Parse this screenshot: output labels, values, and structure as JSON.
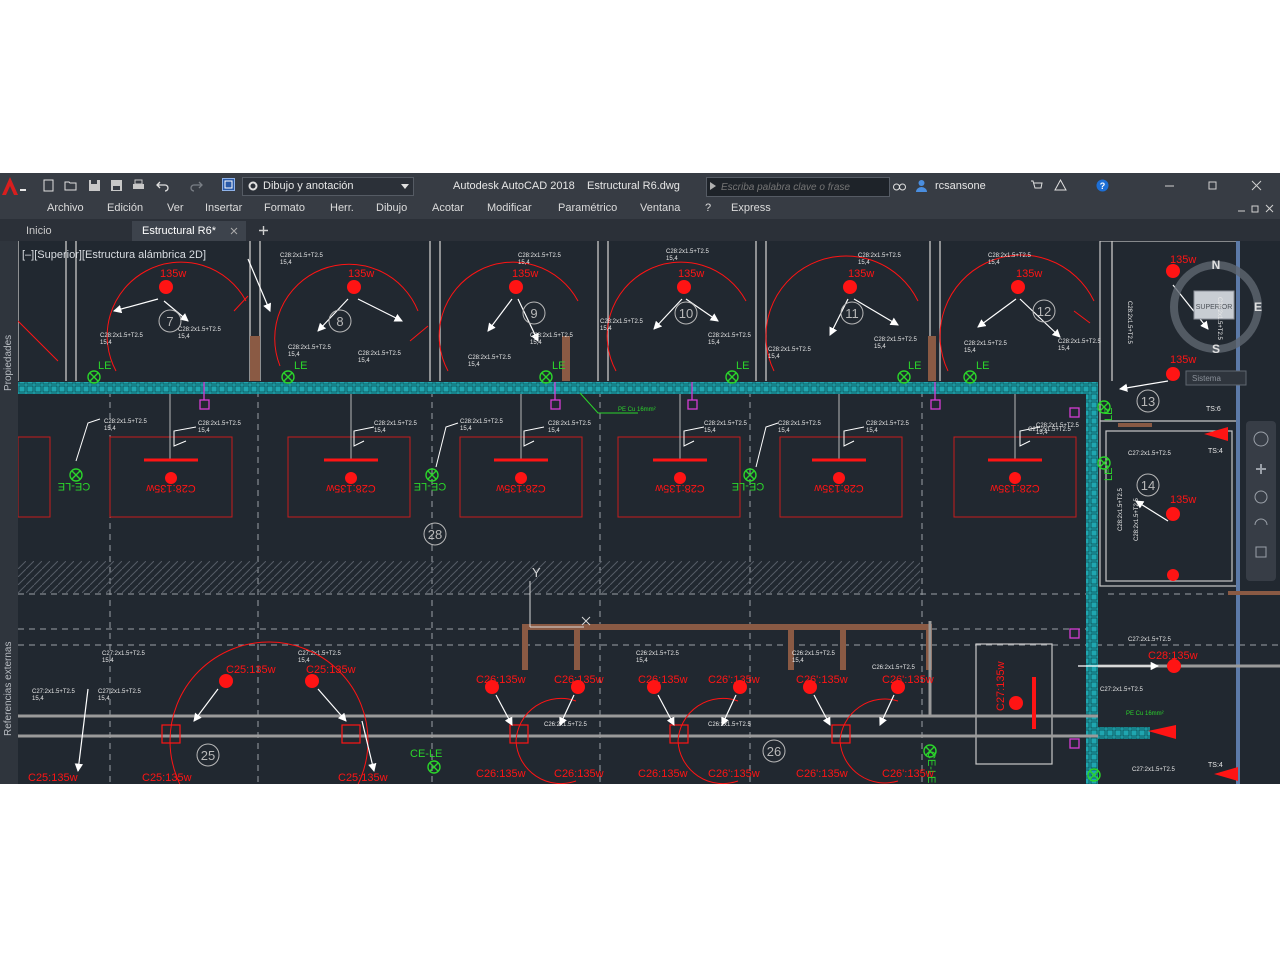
{
  "titlebar": {
    "app_title": "Autodesk AutoCAD 2018",
    "file_name": "Estructural R6.dwg",
    "workspace": "Dibujo y anotación",
    "search_placeholder": "Escriba palabra clave o frase",
    "user": "rcsansone"
  },
  "menu": [
    "Archivo",
    "Edición",
    "Ver",
    "Insertar",
    "Formato",
    "Herr.",
    "Dibujo",
    "Acotar",
    "Modificar",
    "Paramétrico",
    "Ventana",
    "?",
    "Express"
  ],
  "tabs": [
    {
      "label": "Inicio",
      "active": false
    },
    {
      "label": "Estructural R6*",
      "active": true
    }
  ],
  "palettes": {
    "left_top": "Propiedades",
    "left_bottom": "Referencias externas"
  },
  "viewport": {
    "label": "[–][Superior][Estructura alámbrica 2D]",
    "viewcube": {
      "north": "N",
      "south": "S",
      "east": "E",
      "face": "SUPERIOR",
      "ucs": "Sistema"
    },
    "room_numbers": [
      "7",
      "8",
      "9",
      "10",
      "11",
      "12",
      "13",
      "14",
      "28",
      "25",
      "26"
    ],
    "lamp_labels": {
      "c28": "C28:135w",
      "c25": "C25:135w",
      "c26": "C26:135w",
      "c26b": "C26':135w",
      "c27": "C27:135w",
      "top": "135w"
    },
    "emergency_labels": {
      "le": "LE",
      "ce_le": "CE-LE"
    },
    "axis": {
      "y": "Y",
      "x": "X"
    },
    "pe_note": "PE Cu 16mm²",
    "circuit_notes": [
      "C28:2x1.5+T2.5",
      "15,4",
      "C26:2x1.5+T2.5",
      "C25:2x1.5+T2.5",
      "C27:2x1.5+T2.5",
      "TS:6",
      "TS:4"
    ]
  },
  "colors": {
    "background": "#212830",
    "red": "#ff1414",
    "green": "#2bd52b",
    "cyan": "#23c6cf",
    "magenta": "#d43cd4",
    "white": "#e8e8e8",
    "brown": "#8a5a44"
  }
}
